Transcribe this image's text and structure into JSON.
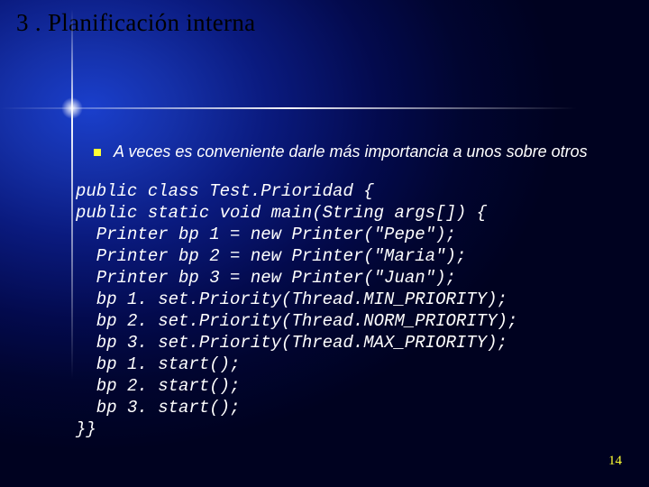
{
  "title": "3 . Planificación interna",
  "bullet": "A veces es  conveniente darle más importancia a unos sobre otros",
  "code": "public class Test.Prioridad {\npublic static void main(String args[]) {\n  Printer bp 1 = new Printer(\"Pepe\");\n  Printer bp 2 = new Printer(\"Maria\");\n  Printer bp 3 = new Printer(\"Juan\");\n  bp 1. set.Priority(Thread.MIN_PRIORITY);\n  bp 2. set.Priority(Thread.NORM_PRIORITY);\n  bp 3. set.Priority(Thread.MAX_PRIORITY);\n  bp 1. start();\n  bp 2. start();\n  bp 3. start();\n}}",
  "page_number": "14"
}
